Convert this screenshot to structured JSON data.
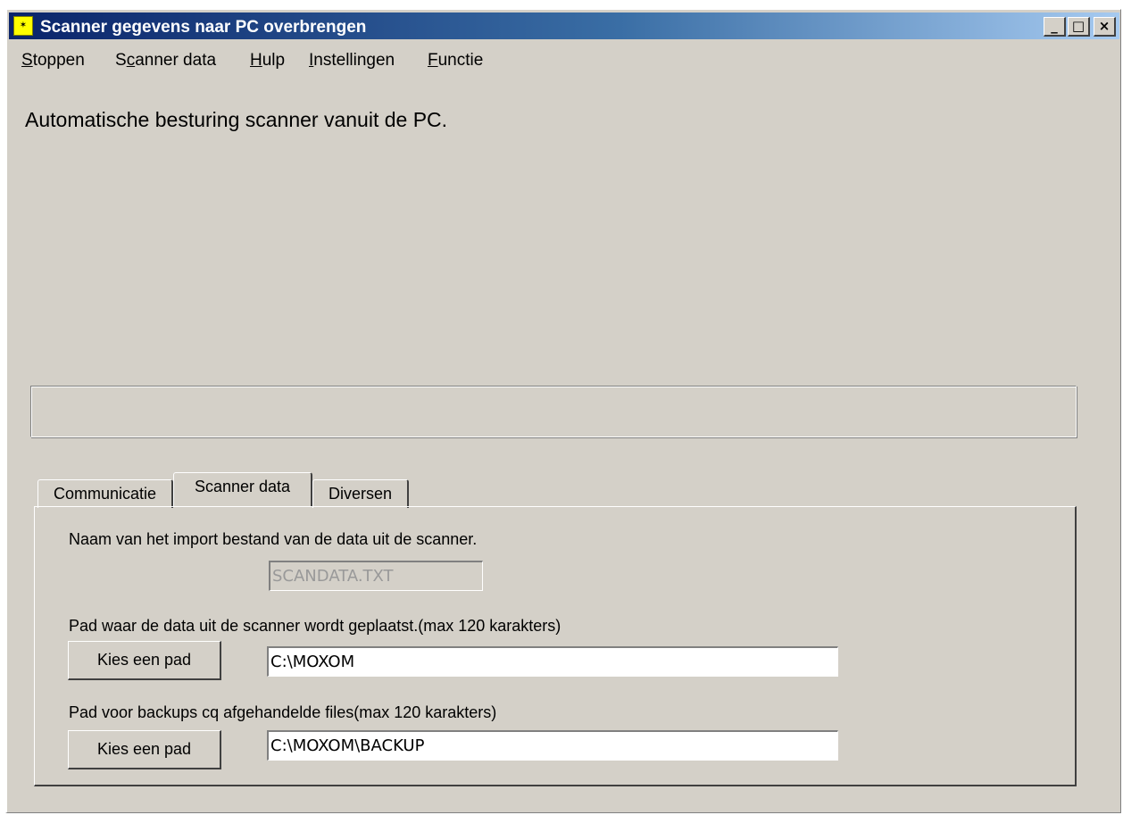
{
  "window": {
    "title": "Scanner gegevens naar PC overbrengen",
    "app_icon_text": "✶",
    "controls": {
      "minimize": "_",
      "maximize": "□",
      "close": "×"
    }
  },
  "menu": {
    "items": [
      {
        "label_before": "",
        "accel": "S",
        "label_after": "toppen"
      },
      {
        "label_before": "S",
        "accel": "c",
        "label_after": "anner data"
      },
      {
        "label_before": "",
        "accel": "H",
        "label_after": "ulp"
      },
      {
        "label_before": "",
        "accel": "I",
        "label_after": "nstellingen"
      },
      {
        "label_before": "",
        "accel": "F",
        "label_after": "unctie"
      }
    ]
  },
  "heading": "Automatische besturing scanner vanuit de PC.",
  "tabs": [
    {
      "label": "Communicatie"
    },
    {
      "label": "Scanner data"
    },
    {
      "label": "Diversen"
    }
  ],
  "active_tab": "Scanner data",
  "scanner_data": {
    "import_label": "Naam van het import bestand van de data uit de scanner.",
    "import_value": "SCANDATA.TXT",
    "path_label": "Pad waar de data uit de scanner wordt geplaatst.(max 120 karakters)",
    "path_button": "Kies een pad",
    "path_value": "C:\\MOXOM",
    "backup_label": "Pad voor backups cq afgehandelde files(max 120 karakters)",
    "backup_button": "Kies een pad",
    "backup_value": "C:\\MOXOM\\BACKUP"
  }
}
